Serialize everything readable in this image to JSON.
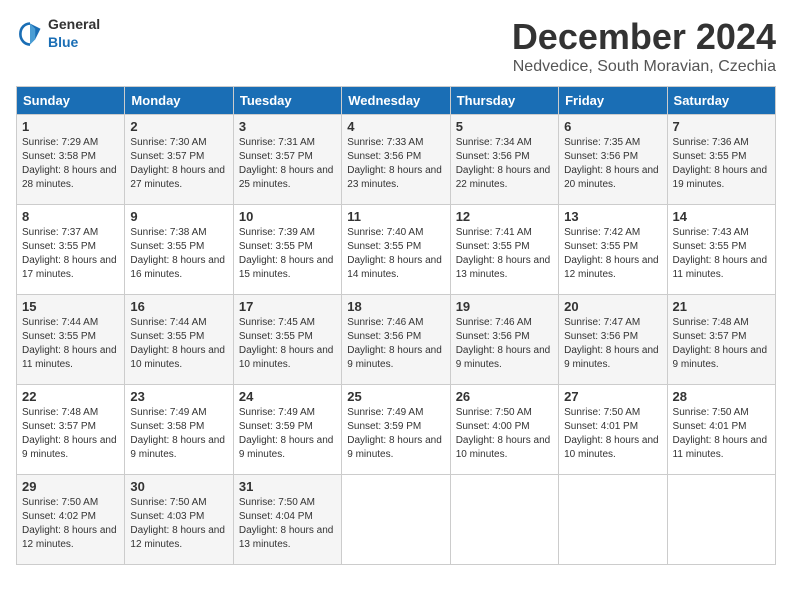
{
  "logo": {
    "general": "General",
    "blue": "Blue"
  },
  "header": {
    "month": "December 2024",
    "location": "Nedvedice, South Moravian, Czechia"
  },
  "weekdays": [
    "Sunday",
    "Monday",
    "Tuesday",
    "Wednesday",
    "Thursday",
    "Friday",
    "Saturday"
  ],
  "weeks": [
    [
      {
        "day": "1",
        "sunrise": "7:29 AM",
        "sunset": "3:58 PM",
        "daylight": "8 hours and 28 minutes."
      },
      {
        "day": "2",
        "sunrise": "7:30 AM",
        "sunset": "3:57 PM",
        "daylight": "8 hours and 27 minutes."
      },
      {
        "day": "3",
        "sunrise": "7:31 AM",
        "sunset": "3:57 PM",
        "daylight": "8 hours and 25 minutes."
      },
      {
        "day": "4",
        "sunrise": "7:33 AM",
        "sunset": "3:56 PM",
        "daylight": "8 hours and 23 minutes."
      },
      {
        "day": "5",
        "sunrise": "7:34 AM",
        "sunset": "3:56 PM",
        "daylight": "8 hours and 22 minutes."
      },
      {
        "day": "6",
        "sunrise": "7:35 AM",
        "sunset": "3:56 PM",
        "daylight": "8 hours and 20 minutes."
      },
      {
        "day": "7",
        "sunrise": "7:36 AM",
        "sunset": "3:55 PM",
        "daylight": "8 hours and 19 minutes."
      }
    ],
    [
      {
        "day": "8",
        "sunrise": "7:37 AM",
        "sunset": "3:55 PM",
        "daylight": "8 hours and 17 minutes."
      },
      {
        "day": "9",
        "sunrise": "7:38 AM",
        "sunset": "3:55 PM",
        "daylight": "8 hours and 16 minutes."
      },
      {
        "day": "10",
        "sunrise": "7:39 AM",
        "sunset": "3:55 PM",
        "daylight": "8 hours and 15 minutes."
      },
      {
        "day": "11",
        "sunrise": "7:40 AM",
        "sunset": "3:55 PM",
        "daylight": "8 hours and 14 minutes."
      },
      {
        "day": "12",
        "sunrise": "7:41 AM",
        "sunset": "3:55 PM",
        "daylight": "8 hours and 13 minutes."
      },
      {
        "day": "13",
        "sunrise": "7:42 AM",
        "sunset": "3:55 PM",
        "daylight": "8 hours and 12 minutes."
      },
      {
        "day": "14",
        "sunrise": "7:43 AM",
        "sunset": "3:55 PM",
        "daylight": "8 hours and 11 minutes."
      }
    ],
    [
      {
        "day": "15",
        "sunrise": "7:44 AM",
        "sunset": "3:55 PM",
        "daylight": "8 hours and 11 minutes."
      },
      {
        "day": "16",
        "sunrise": "7:44 AM",
        "sunset": "3:55 PM",
        "daylight": "8 hours and 10 minutes."
      },
      {
        "day": "17",
        "sunrise": "7:45 AM",
        "sunset": "3:55 PM",
        "daylight": "8 hours and 10 minutes."
      },
      {
        "day": "18",
        "sunrise": "7:46 AM",
        "sunset": "3:56 PM",
        "daylight": "8 hours and 9 minutes."
      },
      {
        "day": "19",
        "sunrise": "7:46 AM",
        "sunset": "3:56 PM",
        "daylight": "8 hours and 9 minutes."
      },
      {
        "day": "20",
        "sunrise": "7:47 AM",
        "sunset": "3:56 PM",
        "daylight": "8 hours and 9 minutes."
      },
      {
        "day": "21",
        "sunrise": "7:48 AM",
        "sunset": "3:57 PM",
        "daylight": "8 hours and 9 minutes."
      }
    ],
    [
      {
        "day": "22",
        "sunrise": "7:48 AM",
        "sunset": "3:57 PM",
        "daylight": "8 hours and 9 minutes."
      },
      {
        "day": "23",
        "sunrise": "7:49 AM",
        "sunset": "3:58 PM",
        "daylight": "8 hours and 9 minutes."
      },
      {
        "day": "24",
        "sunrise": "7:49 AM",
        "sunset": "3:59 PM",
        "daylight": "8 hours and 9 minutes."
      },
      {
        "day": "25",
        "sunrise": "7:49 AM",
        "sunset": "3:59 PM",
        "daylight": "8 hours and 9 minutes."
      },
      {
        "day": "26",
        "sunrise": "7:50 AM",
        "sunset": "4:00 PM",
        "daylight": "8 hours and 10 minutes."
      },
      {
        "day": "27",
        "sunrise": "7:50 AM",
        "sunset": "4:01 PM",
        "daylight": "8 hours and 10 minutes."
      },
      {
        "day": "28",
        "sunrise": "7:50 AM",
        "sunset": "4:01 PM",
        "daylight": "8 hours and 11 minutes."
      }
    ],
    [
      {
        "day": "29",
        "sunrise": "7:50 AM",
        "sunset": "4:02 PM",
        "daylight": "8 hours and 12 minutes."
      },
      {
        "day": "30",
        "sunrise": "7:50 AM",
        "sunset": "4:03 PM",
        "daylight": "8 hours and 12 minutes."
      },
      {
        "day": "31",
        "sunrise": "7:50 AM",
        "sunset": "4:04 PM",
        "daylight": "8 hours and 13 minutes."
      },
      null,
      null,
      null,
      null
    ]
  ]
}
